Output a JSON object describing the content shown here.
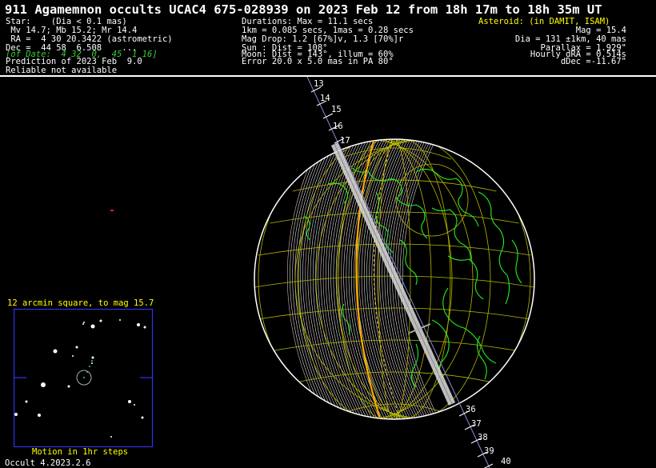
{
  "title": "911 Agamemnon occults UCAC4 675-028939 on 2023 Feb 12 from 18h 17m to 18h 35m UT",
  "left_block": [
    "Star:    (Dia < 0.1 mas)",
    " Mv 14.7; Mb 15.2; Mr 14.4",
    " RA =  4 30 20.3422 (astrometric)",
    "Dec =  44 58  6.508    ...",
    "[of Date:  4 32  0,  45  1 16]",
    "Prediction of 2023 Feb  9.0",
    "Reliable not available"
  ],
  "mid_block": [
    "Durations: Max = 11.1 secs",
    "1km = 0.085 secs, 1mas = 0.28 secs",
    "Mag Drop: 1.2 [67%]v, 1.3 [70%]r",
    "Sun : Dist = 108°",
    "Moon: Dist = 143°, illum = 60%",
    "Error 20.0 x 5.0 mas in PA 80°"
  ],
  "right_block": [
    "Asteroid: (in DAMIT, ISAM)",
    "Mag = 15.4",
    "Dia = 131 ±1km, 40 mas",
    "Parallax = 1.929\"",
    "Hourly dRA = 0.514s",
    "dDec =-11.67\""
  ],
  "inset": {
    "title": "12 arcmin square, to mag 15.7",
    "footer": "Motion in 1hr steps"
  },
  "track_labels_top": [
    "13",
    "14",
    "15",
    "16",
    "17"
  ],
  "track_labels_bottom": [
    "36",
    "37",
    "38",
    "39",
    "40"
  ],
  "version": "Occult 4.2023.2.6",
  "colors": {
    "background": "#000000",
    "text": "#ffffff",
    "asteroid_header": "#ffff00",
    "date_line": "#33cc33",
    "coastline": "#22ee22",
    "grid": "#b8b800",
    "path_edges": "#ffffff",
    "centerline": "#bbbbbb",
    "error_limits": "#ffcc00",
    "sunset_limit": "#ffaa00"
  }
}
